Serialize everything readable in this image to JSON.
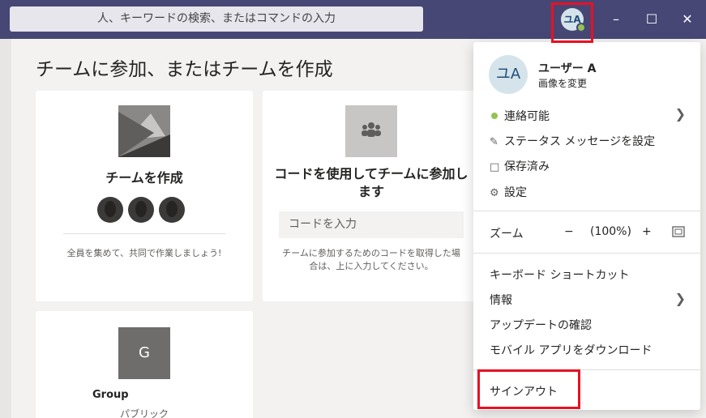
{
  "header": {
    "search_placeholder": "人、キーワードの検索、またはコマンドの入力",
    "avatar_initials": "ユA",
    "minimize_icon": "minimize-icon",
    "maximize_icon": "maximize-icon",
    "close_icon": "close-icon"
  },
  "main": {
    "title": "チームに参加、またはチームを作成",
    "create_card": {
      "title": "チームを作成",
      "description": "全員を集めて、共同で作業しましょう!"
    },
    "join_card": {
      "title": "コードを使用してチームに参加します",
      "input_placeholder": "コードを入力",
      "description": "チームに参加するためのコードを取得した場合は、上に入力してください。"
    },
    "group_card": {
      "initial": "G",
      "name": "Group",
      "type": "パブリック"
    }
  },
  "profile_menu": {
    "avatar_initials": "ユA",
    "user_name": "ユーザー A",
    "change_picture": "画像を変更",
    "status": "連絡可能",
    "status_color": "#92c353",
    "set_status_message": "ステータス メッセージを設定",
    "saved": "保存済み",
    "settings": "設定",
    "zoom_label": "ズーム",
    "zoom_minus": "−",
    "zoom_value": "(100%)",
    "zoom_plus": "+",
    "keyboard_shortcuts": "キーボード ショートカット",
    "about": "情報",
    "check_updates": "アップデートの確認",
    "download_mobile": "モバイル アプリをダウンロード",
    "sign_out": "サインアウト"
  },
  "colors": {
    "titlebar": "#464775",
    "highlight": "#e81123"
  }
}
